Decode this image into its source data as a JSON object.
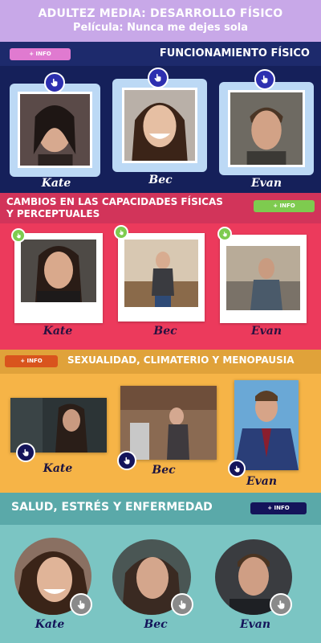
{
  "header": {
    "title": "ADULTEZ MEDIA: DESARROLLO FÍSICO",
    "subtitle": "Película: Nunca me dejes sola"
  },
  "info_label": "+ INFO",
  "sections": [
    {
      "title": "FUNCIONAMIENTO FÍSICO",
      "info_color": "#e07ad0",
      "names": [
        "Kate",
        "Bec",
        "Evan"
      ]
    },
    {
      "title_line1": "CAMBIOS EN LAS CAPACIDADES FÍSICAS",
      "title_line2": "Y PERCEPTUALES",
      "info_color": "#7ecb4f",
      "names": [
        "Kate",
        "Bec",
        "Evan"
      ]
    },
    {
      "title": "SEXUALIDAD, CLIMATERIO Y MENOPAUSIA",
      "info_color": "#d9541d",
      "names": [
        "Kate",
        "Bec",
        "Evan"
      ]
    },
    {
      "title": "SALUD, ESTRÉS Y ENFERMEDAD",
      "info_color": "#14145a",
      "names": [
        "Kate",
        "Bec",
        "Evan"
      ]
    }
  ],
  "icons": {
    "hotspot": "hand-pointer-icon"
  },
  "colors": {
    "purple_header": "#c8a8e8",
    "navy": "#15205a",
    "pink": "#ec3a5c",
    "orange": "#f6b447",
    "teal": "#7bc5c3"
  }
}
